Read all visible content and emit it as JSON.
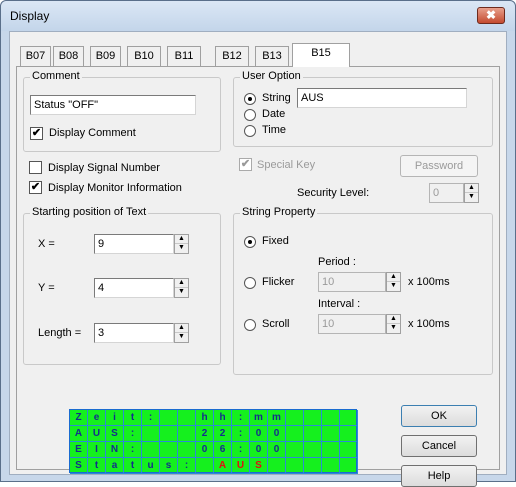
{
  "window": {
    "title": "Display",
    "close_glyph": "✖"
  },
  "tabs": [
    {
      "label": "B07"
    },
    {
      "label": "B08"
    },
    {
      "label": "B09"
    },
    {
      "label": "B10"
    },
    {
      "label": "B11"
    },
    {
      "label": "B12"
    },
    {
      "label": "B13"
    },
    {
      "label": "B15",
      "active": true
    }
  ],
  "comment": {
    "group_label": "Comment",
    "value": "Status \"OFF\"",
    "display_comment_label": "Display Comment",
    "display_comment_checked": true
  },
  "user_option": {
    "group_label": "User Option",
    "string_label": "String",
    "string_value": "AUS",
    "date_label": "Date",
    "time_label": "Time",
    "selected": "String"
  },
  "options": {
    "display_signal_number_label": "Display Signal Number",
    "display_signal_number_checked": false,
    "display_monitor_info_label": "Display Monitor Information",
    "display_monitor_info_checked": true
  },
  "special": {
    "special_key_label": "Special Key",
    "special_key_checked": true,
    "password_label": "Password",
    "security_level_label": "Security Level:",
    "security_level_value": "0"
  },
  "start_pos": {
    "group_label": "Starting position of Text",
    "x_label": "X =",
    "x_value": "9",
    "y_label": "Y =",
    "y_value": "4",
    "length_label": "Length =",
    "length_value": "3"
  },
  "string_property": {
    "group_label": "String Property",
    "fixed_label": "Fixed",
    "flicker_label": "Flicker",
    "scroll_label": "Scroll",
    "selected": "Fixed",
    "period_label": "Period :",
    "period_value": "10",
    "interval_label": "Interval :",
    "interval_value": "10",
    "unit_label": "x 100ms"
  },
  "buttons": {
    "ok": "OK",
    "cancel": "Cancel",
    "help": "Help"
  },
  "lcd": {
    "colors": {
      "background": "#15f01e",
      "text": "#142e8c",
      "highlight": "#e01010"
    },
    "rows": [
      [
        "Z",
        "e",
        "i",
        "t",
        ":",
        "",
        "",
        "h",
        "h",
        ":",
        "m",
        "m",
        "",
        "",
        "",
        ""
      ],
      [
        "A",
        "U",
        "S",
        ":",
        "",
        "",
        "",
        "2",
        "2",
        ":",
        "0",
        "0",
        "",
        "",
        "",
        ""
      ],
      [
        "E",
        "I",
        "N",
        ":",
        "",
        "",
        "",
        "0",
        "6",
        ":",
        "0",
        "0",
        "",
        "",
        "",
        ""
      ],
      [
        "S",
        "t",
        "a",
        "t",
        "u",
        "s",
        ":",
        "",
        "A",
        "U",
        "S",
        "",
        "",
        "",
        "",
        ""
      ]
    ],
    "highlight": [
      [
        3,
        8
      ],
      [
        3,
        9
      ],
      [
        3,
        10
      ]
    ]
  }
}
